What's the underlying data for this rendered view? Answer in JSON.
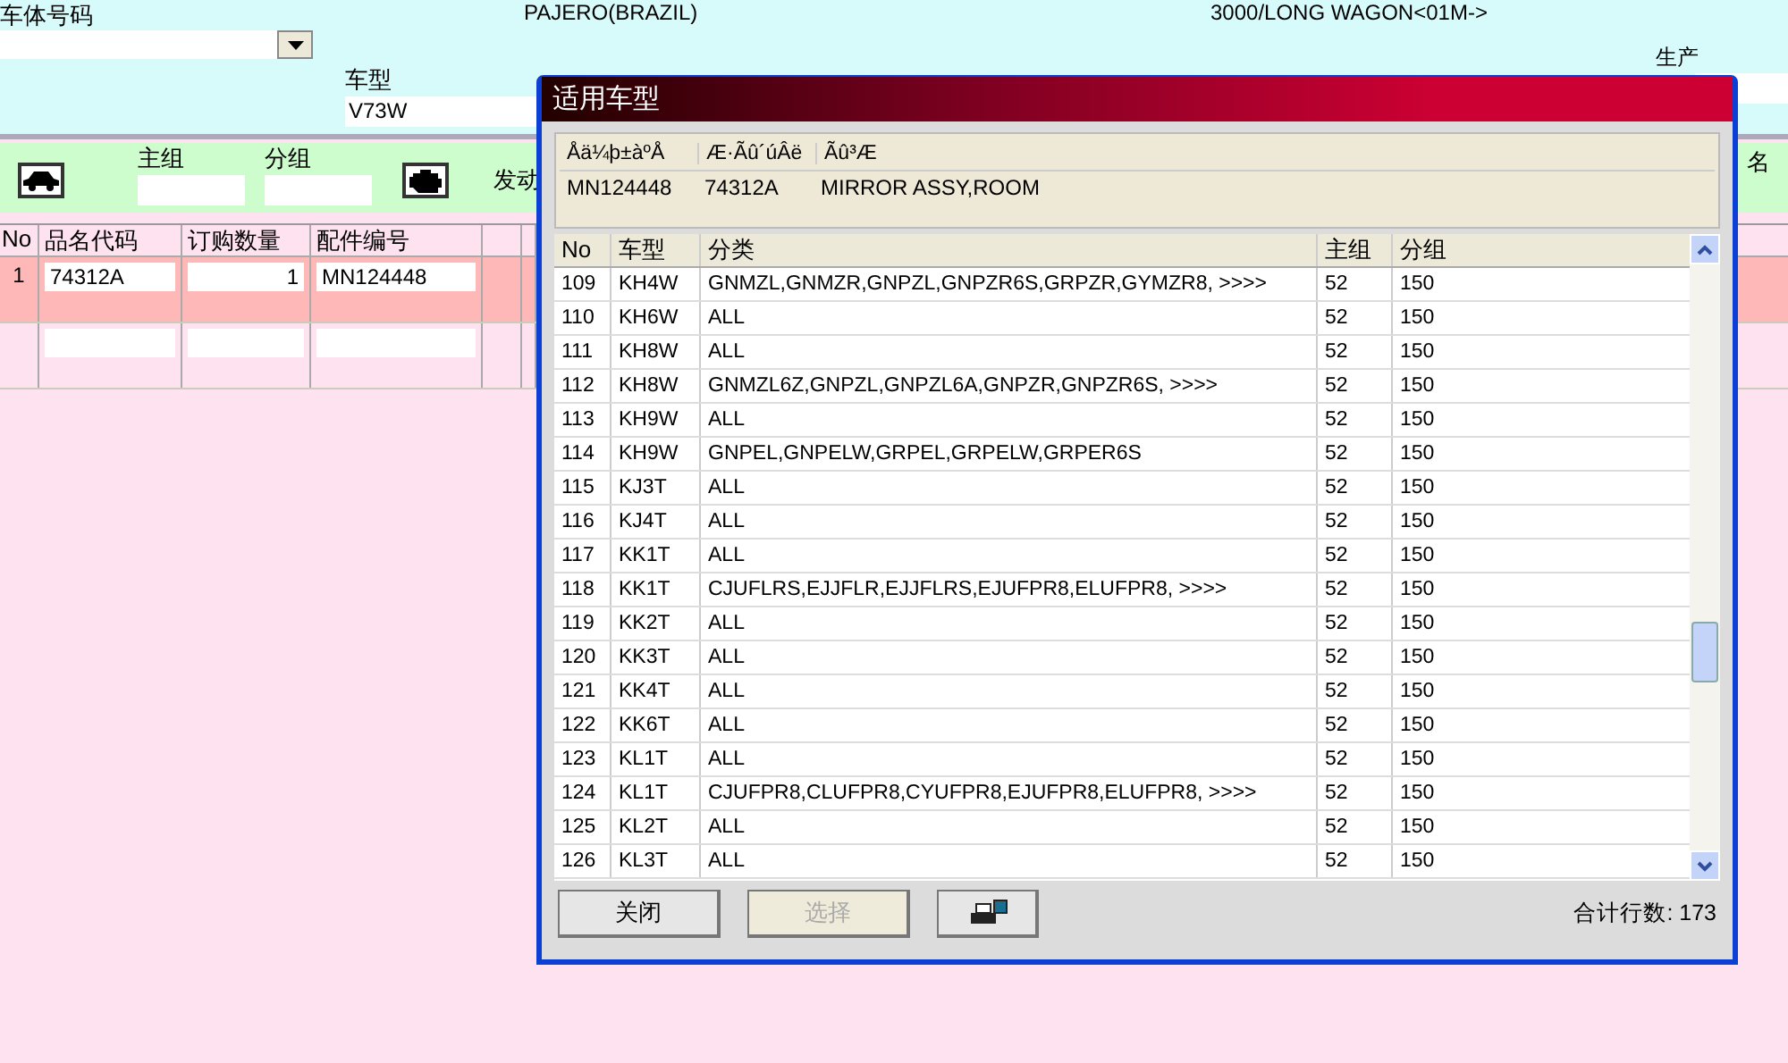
{
  "header": {
    "vin_label": "车体号码",
    "brand": "PAJERO(BRAZIL)",
    "model_desc": "3000/LONG WAGON<01M->",
    "model_label": "车型",
    "model_value": "V73W",
    "production_label": "生产"
  },
  "group_bar": {
    "main_group_label": "主组",
    "sub_group_label": "分组",
    "engine_label": "发动",
    "name_label": "名"
  },
  "order_table": {
    "columns": [
      "No",
      "品名代码",
      "订购数量",
      "配件编号"
    ],
    "rows": [
      {
        "no": "1",
        "code": "74312A",
        "qty": "1",
        "part": "MN124448",
        "selected": true
      },
      {
        "no": "",
        "code": "",
        "qty": "",
        "part": "",
        "selected": false
      }
    ]
  },
  "dialog": {
    "title": "适用车型",
    "info_columns": [
      "Åä¼þ±àºÅ",
      "Æ·Ãû´úÂë",
      "Ãû³Æ"
    ],
    "info_values": [
      "MN124448",
      "74312A",
      "MIRROR ASSY,ROOM"
    ],
    "columns": [
      "No",
      "车型",
      "分类",
      "主组",
      "分组"
    ],
    "rows": [
      [
        "109",
        "KH4W",
        "GNMZL,GNMZR,GNPZL,GNPZR6S,GRPZR,GYMZR8,  >>>>",
        "52",
        "150"
      ],
      [
        "110",
        "KH6W",
        "ALL",
        "52",
        "150"
      ],
      [
        "111",
        "KH8W",
        "ALL",
        "52",
        "150"
      ],
      [
        "112",
        "KH8W",
        "GNMZL6Z,GNPZL,GNPZL6A,GNPZR,GNPZR6S,  >>>>",
        "52",
        "150"
      ],
      [
        "113",
        "KH9W",
        "ALL",
        "52",
        "150"
      ],
      [
        "114",
        "KH9W",
        "GNPEL,GNPELW,GRPEL,GRPELW,GRPER6S",
        "52",
        "150"
      ],
      [
        "115",
        "KJ3T",
        "ALL",
        "52",
        "150"
      ],
      [
        "116",
        "KJ4T",
        "ALL",
        "52",
        "150"
      ],
      [
        "117",
        "KK1T",
        "ALL",
        "52",
        "150"
      ],
      [
        "118",
        "KK1T",
        "CJUFLRS,EJJFLR,EJJFLRS,EJUFPR8,ELUFPR8,  >>>>",
        "52",
        "150"
      ],
      [
        "119",
        "KK2T",
        "ALL",
        "52",
        "150"
      ],
      [
        "120",
        "KK3T",
        "ALL",
        "52",
        "150"
      ],
      [
        "121",
        "KK4T",
        "ALL",
        "52",
        "150"
      ],
      [
        "122",
        "KK6T",
        "ALL",
        "52",
        "150"
      ],
      [
        "123",
        "KL1T",
        "ALL",
        "52",
        "150"
      ],
      [
        "124",
        "KL1T",
        "CJUFPR8,CLUFPR8,CYUFPR8,EJUFPR8,ELUFPR8,  >>>>",
        "52",
        "150"
      ],
      [
        "125",
        "KL2T",
        "ALL",
        "52",
        "150"
      ],
      [
        "126",
        "KL3T",
        "ALL",
        "52",
        "150"
      ]
    ],
    "buttons": [
      {
        "kind": "text",
        "label": "关闭",
        "disabled": false
      },
      {
        "kind": "text",
        "label": "选择",
        "disabled": true
      },
      {
        "kind": "print",
        "disabled": false
      }
    ],
    "total": "合计行数: 173"
  }
}
